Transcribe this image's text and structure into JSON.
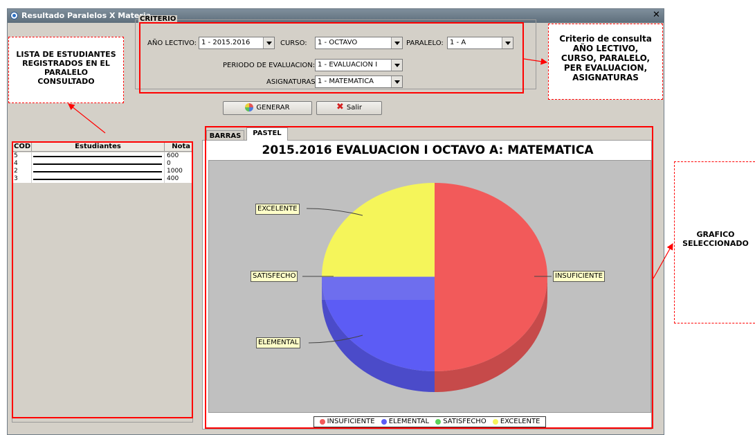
{
  "window": {
    "title": "Resultado Paralelos X Materia"
  },
  "criteria": {
    "legend": "CRITERIO",
    "anio_label": "AÑO LECTIVO:",
    "anio_value": "1 - 2015.2016",
    "curso_label": "CURSO:",
    "curso_value": "1 - OCTAVO",
    "paralelo_label": "PARALELO:",
    "paralelo_value": "1 - A",
    "periodo_label": "PERIODO DE EVALUACION:",
    "periodo_value": "1 - EVALUACION I",
    "asignatura_label": "ASIGNATURAS:",
    "asignatura_value": "1 - MATEMATICA"
  },
  "buttons": {
    "generar": "GENERAR",
    "salir": "Salir"
  },
  "students": {
    "headers": [
      "COD",
      "Estudiantes",
      "Nota"
    ],
    "rows": [
      {
        "cod": "5",
        "name": "ALVARADO ORTIZ JUAN EDUARDO",
        "nota": "600"
      },
      {
        "cod": "4",
        "name": "MARCILLO ACOSTA JAIR JEAMPIER",
        "nota": "0"
      },
      {
        "cod": "2",
        "name": "PALMA BARRIONUEVO OMAR",
        "nota": "1000"
      },
      {
        "cod": "3",
        "name": "RAMOS CARDENAS OLMES",
        "nota": "400"
      }
    ]
  },
  "tabs": [
    "BARRAS",
    "PASTEL"
  ],
  "chart_data": {
    "type": "pie",
    "title": "2015.2016 EVALUACION I OCTAVO A:  MATEMATICA",
    "categories": [
      "INSUFICIENTE",
      "ELEMENTAL",
      "SATISFECHO",
      "EXCELENTE"
    ],
    "values": [
      50,
      25,
      0,
      25
    ],
    "colors": [
      "#f25a5a",
      "#5c5cf5",
      "#5ad25a",
      "#f5f55a"
    ],
    "legend": "bottom"
  },
  "annotations": {
    "left": "LISTA DE ESTUDIANTES REGISTRADOS EN EL PARALELO CONSULTADO",
    "criteria_title": "Criterio de consulta",
    "criteria_body": "AÑO LECTIVO, CURSO, PARALELO, PER EVALUACION, ASIGNATURAS",
    "grafico": "GRAFICO SELECCIONADO"
  }
}
